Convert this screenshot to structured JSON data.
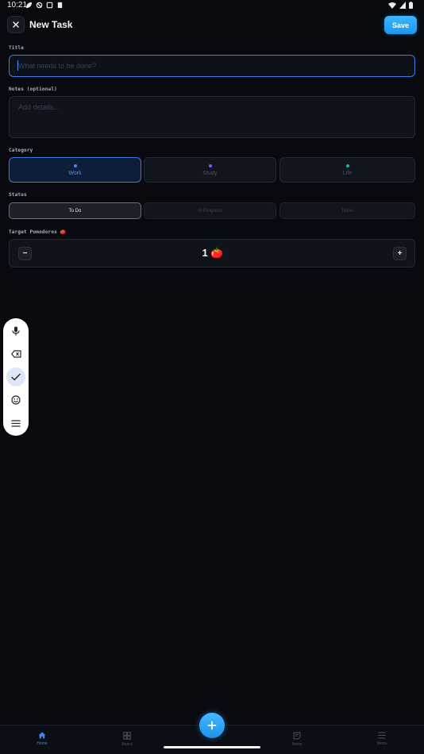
{
  "status_bar": {
    "time": "10:21"
  },
  "header": {
    "title": "New Task",
    "save_label": "Save"
  },
  "title_field": {
    "label": "Title",
    "placeholder": "What needs to be done?",
    "value": ""
  },
  "notes_field": {
    "label": "Notes (optional)",
    "placeholder": "Add details...",
    "value": ""
  },
  "category": {
    "label": "Category",
    "options": [
      {
        "label": "Work",
        "color": "#4d86f2",
        "selected": true
      },
      {
        "label": "Study",
        "color": "#7b5cf0",
        "selected": false
      },
      {
        "label": "Life",
        "color": "#1bb89a",
        "selected": false
      }
    ]
  },
  "status": {
    "label": "Status",
    "options": [
      {
        "label": "To Do",
        "selected": true
      },
      {
        "label": "In Progress",
        "selected": false
      },
      {
        "label": "Done",
        "selected": false
      }
    ]
  },
  "pomodoros": {
    "label": "Target Pomodoros 🍅",
    "value": "1 🍅",
    "minus": "−",
    "plus": "+"
  },
  "keyboard_toolbar": [
    "microphone-icon",
    "backspace-icon",
    "check-icon",
    "emoji-icon",
    "menu-icon"
  ],
  "bottom_nav": [
    {
      "label": "Home",
      "icon": "home-icon",
      "active": true
    },
    {
      "label": "Board",
      "icon": "board-icon",
      "active": false
    },
    {
      "label": "Notes",
      "icon": "notes-icon",
      "active": false
    },
    {
      "label": "Menu",
      "icon": "menu-icon",
      "active": false
    }
  ],
  "colors": {
    "accent": "#3d86f0",
    "save": "#2aa6f7",
    "background": "#080a0f"
  }
}
